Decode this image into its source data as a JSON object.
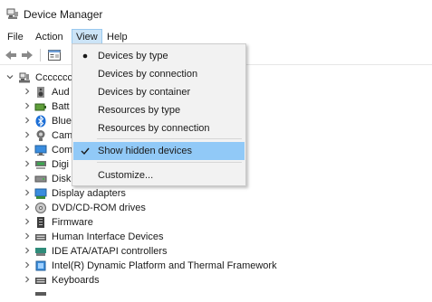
{
  "window": {
    "title": "Device Manager"
  },
  "menubar": {
    "file": "File",
    "action": "Action",
    "view": "View",
    "help": "Help"
  },
  "view_menu": {
    "items": [
      {
        "label": "Devices by type",
        "state": "radio-selected"
      },
      {
        "label": "Devices by connection"
      },
      {
        "label": "Devices by container"
      },
      {
        "label": "Resources by type"
      },
      {
        "label": "Resources by connection"
      },
      {
        "label": "Show hidden devices",
        "state": "checked"
      },
      {
        "label": "Customize..."
      }
    ]
  },
  "tree": {
    "root": {
      "label": "Cccccccc",
      "icon": "computer-icon"
    },
    "items": [
      {
        "label": "Aud",
        "icon": "speaker-icon"
      },
      {
        "label": "Batt",
        "icon": "battery-icon"
      },
      {
        "label": "Blue",
        "icon": "bluetooth-icon"
      },
      {
        "label": "Cam",
        "icon": "camera-icon"
      },
      {
        "label": "Com",
        "icon": "monitor-icon"
      },
      {
        "label": "Digi",
        "icon": "digitizer-icon"
      },
      {
        "label": "Disk",
        "icon": "disk-drive-icon"
      },
      {
        "label": "Display adapters",
        "icon": "display-adapter-icon"
      },
      {
        "label": "DVD/CD-ROM drives",
        "icon": "dvd-icon"
      },
      {
        "label": "Firmware",
        "icon": "firmware-icon"
      },
      {
        "label": "Human Interface Devices",
        "icon": "keyboard-hid-icon"
      },
      {
        "label": "IDE ATA/ATAPI controllers",
        "icon": "controller-icon"
      },
      {
        "label": "Intel(R) Dynamic Platform and Thermal Framework",
        "icon": "chip-icon"
      },
      {
        "label": "Keyboards",
        "icon": "keyboard-icon"
      }
    ]
  },
  "colors": {
    "menu_highlight": "#91c9f7",
    "menu_bg": "#f2f2f2",
    "active_menu": "#cce4f7"
  }
}
